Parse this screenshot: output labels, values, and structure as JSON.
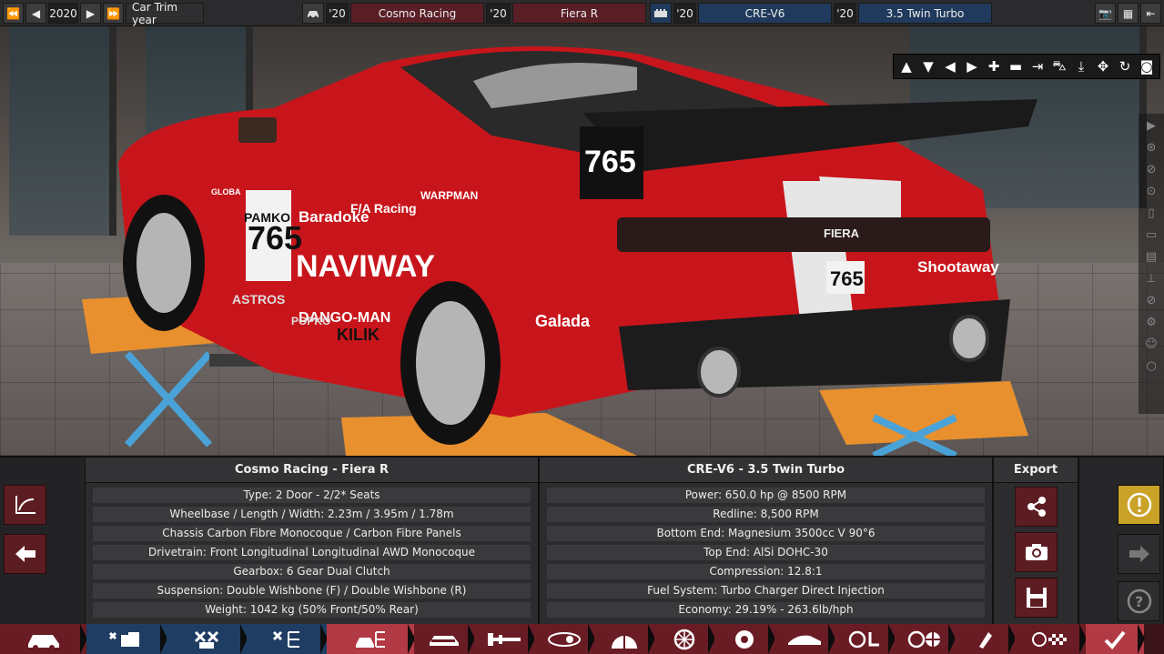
{
  "topbar": {
    "year": "2020",
    "year_label": "Car Trim year",
    "model_year": "'20",
    "family_year": "'20",
    "engine_year": "'20",
    "variant_year": "'20",
    "company": "Cosmo Racing",
    "model": "Fiera R",
    "engine_family": "CRE-V6",
    "engine_variant": "3.5 Twin Turbo"
  },
  "viewport": {
    "decals": [
      "765",
      "765",
      "765",
      "PAMKO",
      "Baradoke",
      "NAVIWAY",
      "DANGO-MAN",
      "ASTROS",
      "POPKO",
      "KILIK",
      "F/A Racing",
      "Galada",
      "Shootaway",
      "FIERA",
      "GLOBA",
      "WARPMAN"
    ],
    "camera_tools": [
      "arrow-up-icon",
      "arrow-down-icon",
      "arrow-left-icon",
      "arrow-right-icon",
      "zoom-in-icon",
      "zoom-out-icon",
      "reset-view-icon",
      "car-view-icon",
      "ground-icon",
      "rotate-icon",
      "spin-icon",
      "camera-icon"
    ],
    "sidebar_icons": [
      "play-icon",
      "wheel-icon",
      "fuel-icon",
      "seats-icon",
      "door-icon",
      "car-side-icon",
      "grille-icon",
      "lift-icon",
      "no-entry-icon",
      "gear-icon",
      "person-icon",
      "circle-icon"
    ]
  },
  "car_info": {
    "title": "Cosmo Racing - Fiera R",
    "rows": [
      "Type: 2 Door - 2/2* Seats",
      "Wheelbase / Length / Width: 2.23m / 3.95m / 1.78m",
      "Chassis Carbon Fibre Monocoque / Carbon Fibre Panels",
      "Drivetrain: Front Longitudinal Longitudinal AWD Monocoque",
      "Gearbox: 6 Gear Dual Clutch",
      "Suspension: Double Wishbone (F) / Double Wishbone (R)",
      "Weight: 1042 kg (50% Front/50% Rear)"
    ]
  },
  "engine_info": {
    "title": "CRE-V6 - 3.5 Twin Turbo",
    "rows": [
      "Power: 650.0 hp @ 8500 RPM",
      "Redline:  8,500 RPM",
      "Bottom End: Magnesium 3500cc V 90°6",
      "Top End: AlSi DOHC-30",
      "Compression: 12.8:1",
      "Fuel System: Turbo Charger Direct Injection",
      "Economy: 29.19% - 263.6lb/hph"
    ]
  },
  "export": {
    "title": "Export"
  },
  "colors": {
    "accent_red": "#5c1d22",
    "accent_blue": "#1f3d63",
    "warning_yellow": "#c9a227",
    "active_tab": "#b23a44"
  },
  "bottom_nav": [
    "car-icon",
    "engine-folder-icon",
    "engine-icon",
    "engine-tree-icon",
    "car-engine-icon",
    "chassis-icon",
    "drivetrain-icon",
    "gearbox-icon",
    "suspension-icon",
    "brakes-icon",
    "aero-icon",
    "steering-icon",
    "safety-icon",
    "fuel-icon",
    "testing-icon",
    "confirm-icon"
  ]
}
